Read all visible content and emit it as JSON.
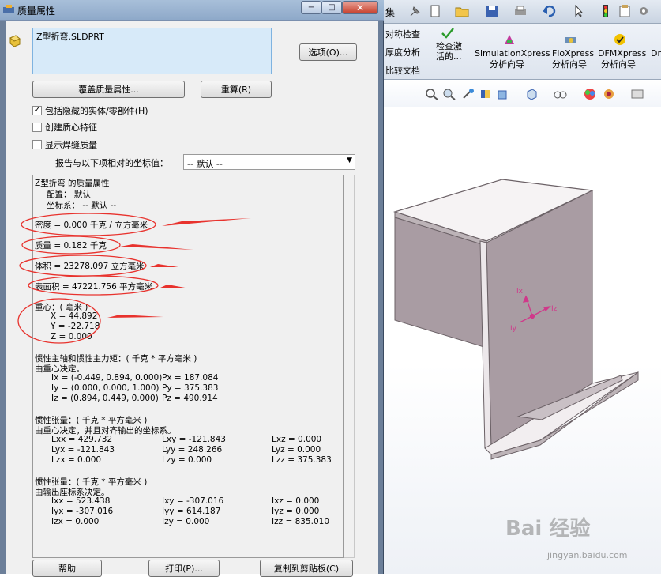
{
  "dialog": {
    "title": "质量属性",
    "file_name": "Z型折弯.SLDPRT",
    "options_button": "选项(O)...",
    "override_button": "覆盖质量属性...",
    "recalc_button": "重算(R)",
    "checkboxes": [
      {
        "label": "包括隐藏的实体/零部件(H)",
        "checked": true
      },
      {
        "label": "创建质心特征",
        "checked": false
      },
      {
        "label": "显示焊缝质量",
        "checked": false
      }
    ],
    "coord_label": "报告与以下项相对的坐标值：",
    "coord_value": "-- 默认 --",
    "help_button": "帮助",
    "print_button": "打印(P)...",
    "copy_button": "复制到剪贴板(C)",
    "window_buttons": {
      "minimize": "−",
      "maximize": "□",
      "close": "✕"
    },
    "results": {
      "header": "Z型折弯 的质量属性",
      "config": "配置： 默认",
      "coordsys": "坐标系： -- 默认 --",
      "density": "密度 = 0.000 千克 / 立方毫米",
      "mass": "质量 = 0.182 千克",
      "volume": "体积 = 23278.097 立方毫米",
      "surface_area": "表面积 = 47221.756  平方毫米",
      "cog_title": "重心：( 毫米 )",
      "cog_x": "X = 44.892",
      "cog_y": "Y = -22.718",
      "cog_z": "Z = 0.000",
      "principal_title": "惯性主轴和惯性主力矩：( 千克 *  平方毫米 )",
      "principal_sub": "由重心决定。",
      "principal_rows": [
        {
          "axis": "Ix = (-0.449, 0.894, 0.000)",
          "moment": "Px = 187.084"
        },
        {
          "axis": "Iy = (0.000, 0.000, 1.000)",
          "moment": "Py = 375.383"
        },
        {
          "axis": "Iz = (0.894, 0.449, 0.000)",
          "moment": "Pz = 490.914"
        }
      ],
      "tensor1_title": "惯性张量：( 千克 *  平方毫米 )",
      "tensor1_sub": "由重心决定，并且对齐输出的坐标系。",
      "tensor1_rows": [
        [
          "Lxx = 429.732",
          "Lxy = -121.843",
          "Lxz = 0.000"
        ],
        [
          "Lyx = -121.843",
          "Lyy = 248.266",
          "Lyz = 0.000"
        ],
        [
          "Lzx = 0.000",
          "Lzy = 0.000",
          "Lzz = 375.383"
        ]
      ],
      "tensor2_title": "惯性张量：( 千克 *  平方毫米 )",
      "tensor2_sub": "由输出座标系决定。",
      "tensor2_rows": [
        [
          "Ixx = 523.438",
          "Ixy = -307.016",
          "Ixz = 0.000"
        ],
        [
          "Iyx = -307.016",
          "Iyy = 614.187",
          "Iyz = 0.000"
        ],
        [
          "Izx = 0.000",
          "Izy = 0.000",
          "Izz = 835.010"
        ]
      ]
    }
  },
  "solidworks": {
    "top_label": "集",
    "ribbon_left": [
      "对称检查",
      "厚度分析",
      "比较文档"
    ],
    "check_active": "检查激活的...",
    "tools": [
      {
        "line1": "SimulationXpress",
        "line2": "分析向导"
      },
      {
        "line1": "FloXpress",
        "line2": "分析向导"
      },
      {
        "line1": "DFMXpress",
        "line2": "分析向导"
      },
      {
        "line1": "Dr",
        "line2": ""
      }
    ],
    "axis_labels": [
      "Ix",
      "Iy",
      "Iz"
    ]
  },
  "watermark": {
    "logo": "Bai 经验",
    "url": "jingyan.baidu.com"
  },
  "colors": {
    "annotation_red": "#e8322d",
    "part_face": "#a99ca3",
    "part_face_light": "#d8d0d4",
    "axis_pink": "#d0388a"
  }
}
